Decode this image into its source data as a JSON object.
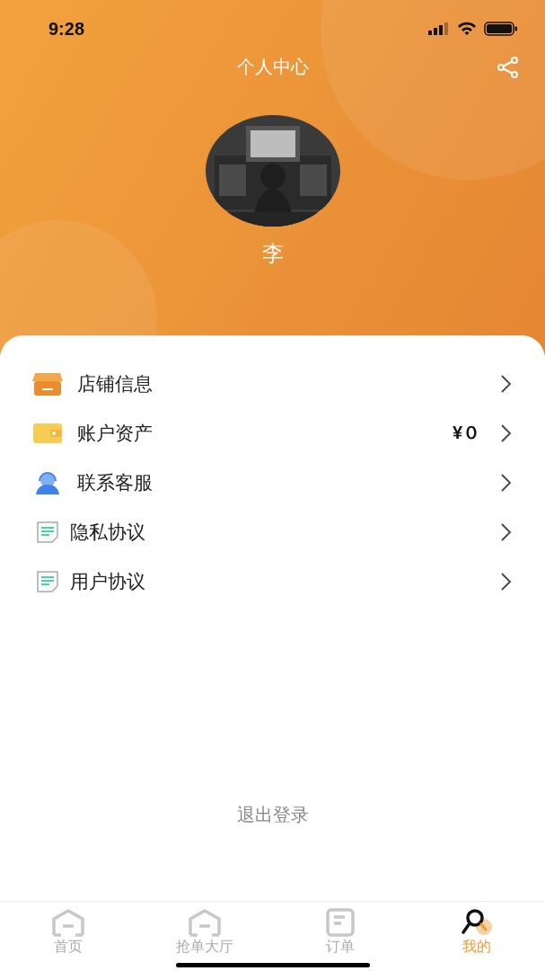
{
  "status_bar": {
    "time": "9:28"
  },
  "header": {
    "title": "个人中心",
    "user_name": "李"
  },
  "menu": [
    {
      "kind": "store",
      "label": "店铺信息"
    },
    {
      "kind": "wallet",
      "label": "账户资产",
      "value": "¥０"
    },
    {
      "kind": "service",
      "label": "联系客服"
    },
    {
      "kind": "document",
      "label": "隐私协议"
    },
    {
      "kind": "document",
      "label": "用户协议"
    }
  ],
  "logout": "退出登录",
  "tabs": [
    {
      "kind": "home",
      "label": "首页",
      "selected": false
    },
    {
      "kind": "home",
      "label": "抢单大厅",
      "selected": false
    },
    {
      "kind": "orders",
      "label": "订单",
      "selected": false
    },
    {
      "kind": "profile",
      "label": "我的",
      "selected": true
    }
  ]
}
